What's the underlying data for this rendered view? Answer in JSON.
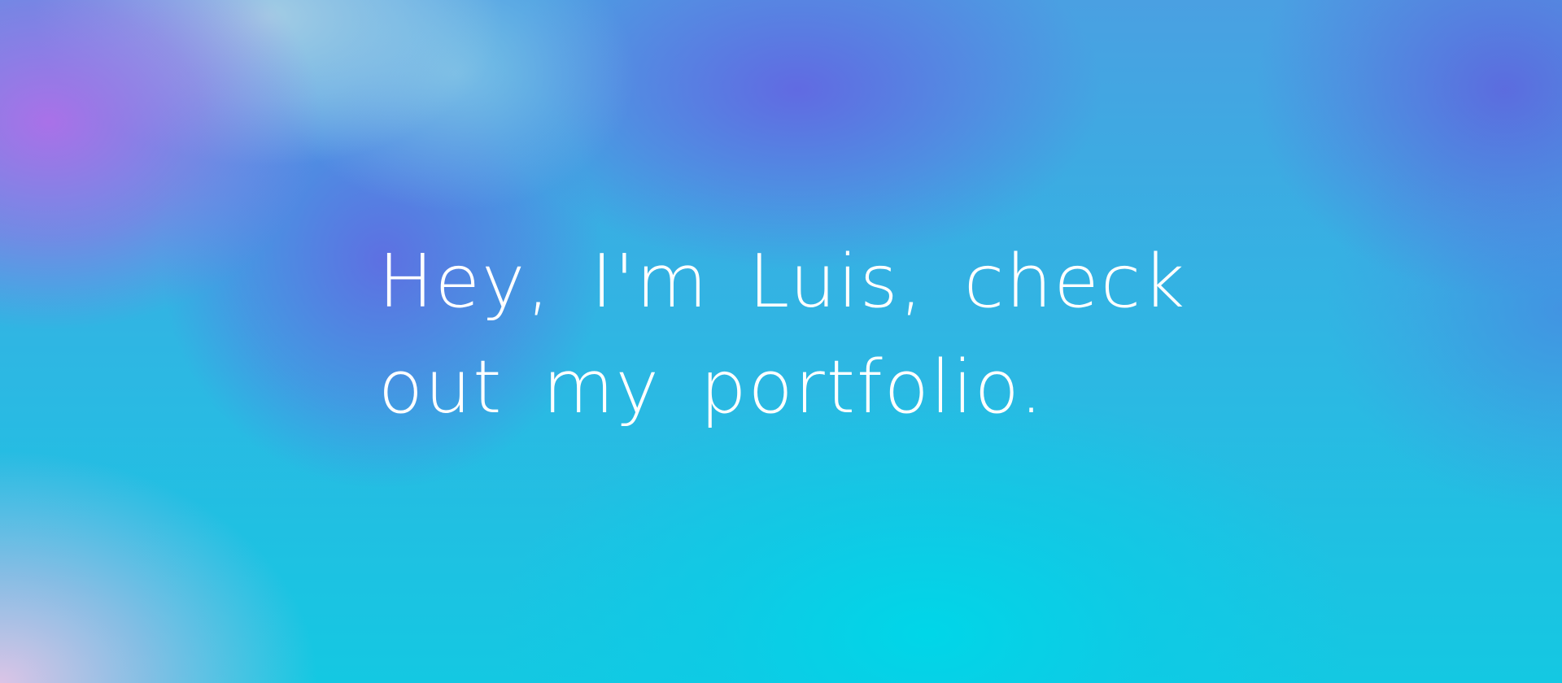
{
  "hero": {
    "headline_line1": "Hey, I'm Luis, check",
    "headline_line2": "out my portfolio."
  },
  "colors": {
    "text": "#ffffff",
    "top_left_purple": "#af6ee8",
    "top_light_blue": "#a5cde4",
    "mid_indigo": "#6269e2",
    "center_blue": "#2fb6e3",
    "bottom_cyan": "#00d6e8",
    "bottom_left_pink": "#e6c4e6"
  }
}
